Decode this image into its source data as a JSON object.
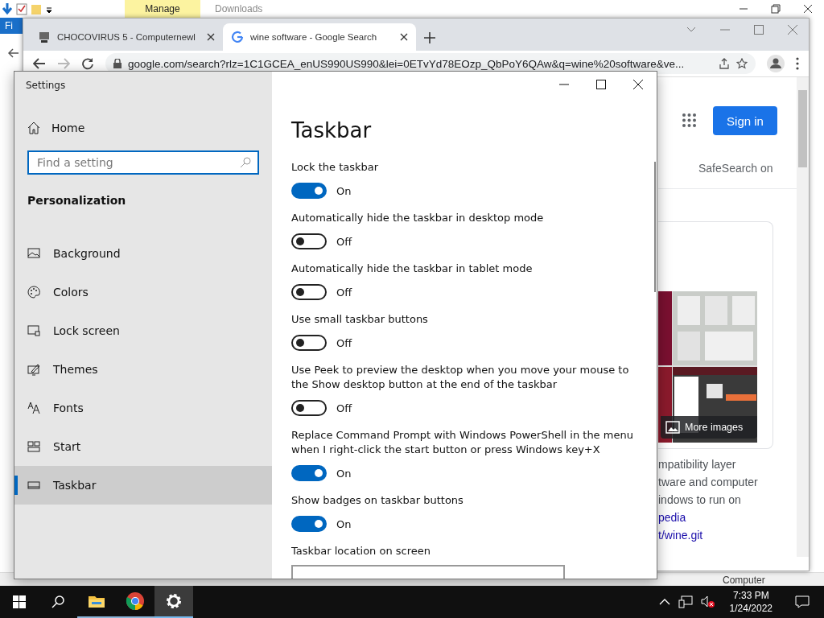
{
  "explorer": {
    "ribbon_tab": "Manage",
    "title": "Downloads",
    "file_tab": "Fi",
    "status_right": "Computer"
  },
  "browser": {
    "tabs": [
      {
        "title": "CHOCOVIRUS 5 - Computernewl",
        "selected": false
      },
      {
        "title": "wine software - Google Search",
        "selected": true
      }
    ],
    "address": "google.com/search?rlz=1C1GCEA_enUS990US990&lei=0ETvYd78EOzp_QbPoY6QAw&q=wine%20software&ve...",
    "sign_in": "Sign in",
    "safesearch": "SafeSearch on",
    "more_images": "More images",
    "snippet": [
      {
        "text": "mpatibility layer",
        "kind": "text"
      },
      {
        "text": "tware and computer",
        "kind": "text"
      },
      {
        "text": "indows to run on",
        "kind": "text"
      },
      {
        "text": "pedia",
        "kind": "link"
      },
      {
        "text": "t/wine.git",
        "kind": "link"
      }
    ]
  },
  "settings": {
    "title": "Settings",
    "home": "Home",
    "search": {
      "placeholder": "Find a setting"
    },
    "section": "Personalization",
    "nav": [
      {
        "label": "Background",
        "selected": false
      },
      {
        "label": "Colors",
        "selected": false
      },
      {
        "label": "Lock screen",
        "selected": false
      },
      {
        "label": "Themes",
        "selected": false
      },
      {
        "label": "Fonts",
        "selected": false
      },
      {
        "label": "Start",
        "selected": false
      },
      {
        "label": "Taskbar",
        "selected": true
      }
    ],
    "page_title": "Taskbar",
    "options": [
      {
        "label": "Lock the taskbar",
        "on": true,
        "state": "On"
      },
      {
        "label": "Automatically hide the taskbar in desktop mode",
        "on": false,
        "state": "Off"
      },
      {
        "label": "Automatically hide the taskbar in tablet mode",
        "on": false,
        "state": "Off"
      },
      {
        "label": "Use small taskbar buttons",
        "on": false,
        "state": "Off"
      },
      {
        "label": "Use Peek to preview the desktop when you move your mouse to the Show desktop button at the end of the taskbar",
        "on": false,
        "state": "Off"
      },
      {
        "label": "Replace Command Prompt with Windows PowerShell in the menu when I right-click the start button or press Windows key+X",
        "on": true,
        "state": "On"
      },
      {
        "label": "Show badges on taskbar buttons",
        "on": true,
        "state": "On"
      }
    ],
    "next_heading": "Taskbar location on screen"
  },
  "taskbar": {
    "apps": [
      {
        "kind": "explorer",
        "selected": false
      },
      {
        "kind": "chrome",
        "selected": false
      },
      {
        "kind": "settings",
        "selected": true
      }
    ],
    "time": "7:33 PM",
    "date": "1/24/2022"
  }
}
